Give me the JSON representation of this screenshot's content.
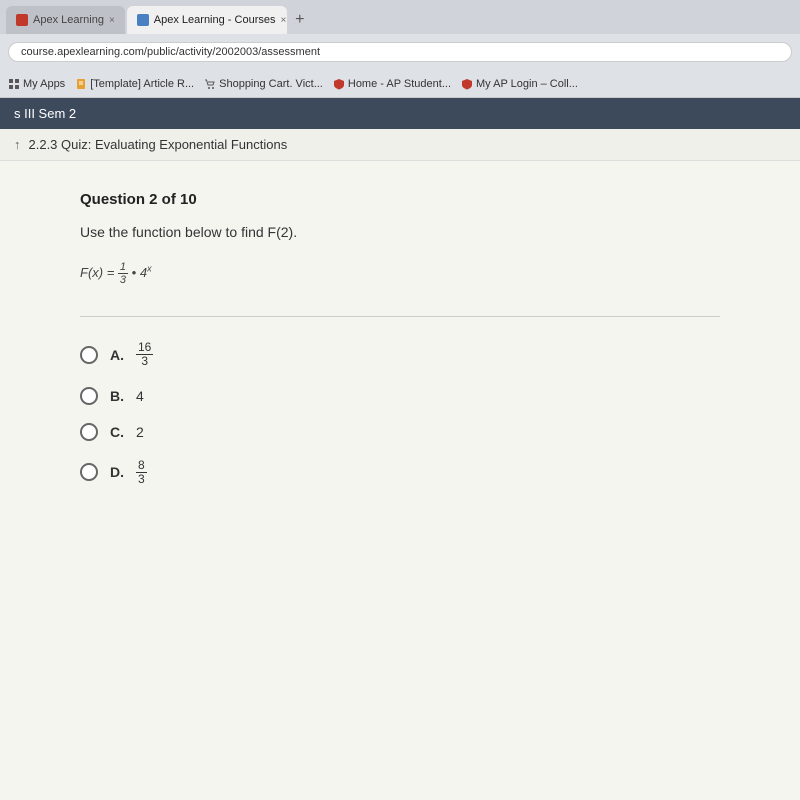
{
  "browser": {
    "tabs": [
      {
        "id": "tab1",
        "label": "Apex Learning",
        "active": false,
        "favicon_color": "red"
      },
      {
        "id": "tab2",
        "label": "Apex Learning - Courses",
        "active": true,
        "favicon_color": "blue"
      }
    ],
    "address": "course.apexlearning.com/public/activity/2002003/assessment",
    "bookmarks": [
      {
        "label": "My Apps",
        "icon": "apps"
      },
      {
        "label": "[Template] Article R...",
        "icon": "doc"
      },
      {
        "label": "Shopping Cart. Vict...",
        "icon": "cart"
      },
      {
        "label": "Home - AP Student...",
        "icon": "home"
      },
      {
        "label": "My AP Login – Coll...",
        "icon": "home"
      }
    ]
  },
  "course": {
    "breadcrumb": "s III Sem 2",
    "quiz_nav_icon": "↑",
    "quiz_title": "2.2.3 Quiz: Evaluating Exponential Functions"
  },
  "question": {
    "number": "Question 2 of 10",
    "text": "Use the function below to find F(2).",
    "function_label": "F(x) =",
    "function_fraction_num": "1",
    "function_fraction_den": "3",
    "function_suffix": "• 4",
    "function_exponent": "x",
    "options": [
      {
        "id": "A",
        "label": "A.",
        "value_num": "16",
        "value_den": "3",
        "is_fraction": true
      },
      {
        "id": "B",
        "label": "B.",
        "value": "4",
        "is_fraction": false
      },
      {
        "id": "C",
        "label": "C.",
        "value": "2",
        "is_fraction": false
      },
      {
        "id": "D",
        "label": "D.",
        "value_num": "8",
        "value_den": "3",
        "is_fraction": true
      }
    ]
  }
}
